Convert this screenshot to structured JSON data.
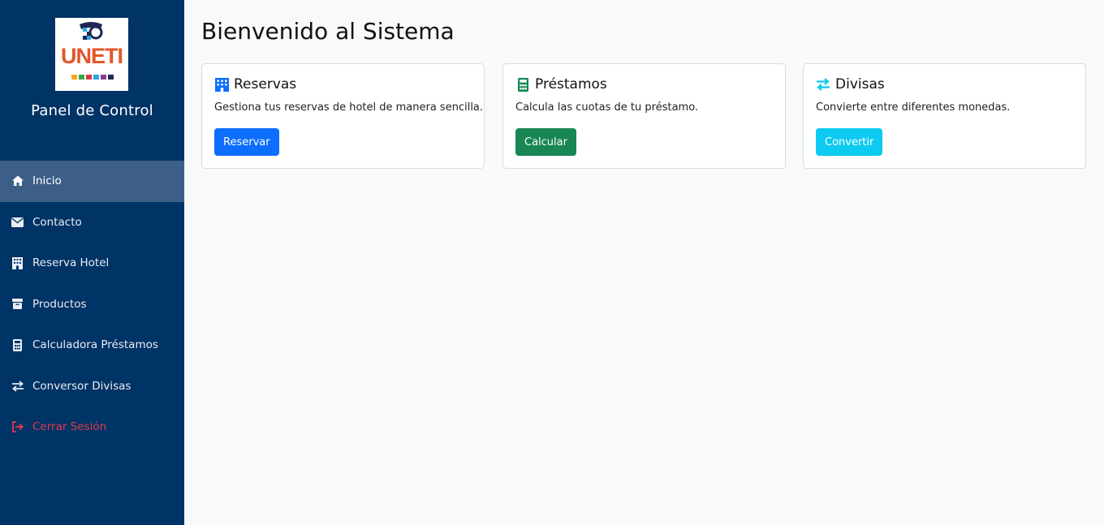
{
  "sidebar": {
    "logo_text": "UNETI",
    "title": "Panel de Control",
    "items": [
      {
        "label": "Inicio",
        "icon": "home-icon",
        "active": true
      },
      {
        "label": "Contacto",
        "icon": "envelope-icon"
      },
      {
        "label": "Reserva Hotel",
        "icon": "building-icon"
      },
      {
        "label": "Productos",
        "icon": "box-icon"
      },
      {
        "label": "Calculadora Préstamos",
        "icon": "calculator-icon"
      },
      {
        "label": "Conversor Divisas",
        "icon": "exchange-icon"
      },
      {
        "label": "Cerrar Sesión",
        "icon": "logout-icon",
        "color": "#e03a4a"
      }
    ]
  },
  "main": {
    "title": "Bienvenido al Sistema",
    "cards": [
      {
        "title": "Reservas",
        "icon": "building-icon",
        "icon_color": "#0d6efd",
        "text": "Gestiona tus reservas de hotel de manera sencilla.",
        "button": "Reservar",
        "button_color": "#0d6efd"
      },
      {
        "title": "Préstamos",
        "icon": "calculator-icon",
        "icon_color": "#198754",
        "text": "Calcula las cuotas de tu préstamo.",
        "button": "Calcular",
        "button_color": "#198754"
      },
      {
        "title": "Divisas",
        "icon": "exchange-icon",
        "icon_color": "#0dcaf0",
        "text": "Convierte entre diferentes monedas.",
        "button": "Convertir",
        "button_color": "#0dcaf0"
      }
    ]
  },
  "colors": {
    "sidebar_bg": "#003366",
    "sidebar_active": "#3d5f87",
    "page_bg": "#f8f9fa"
  }
}
